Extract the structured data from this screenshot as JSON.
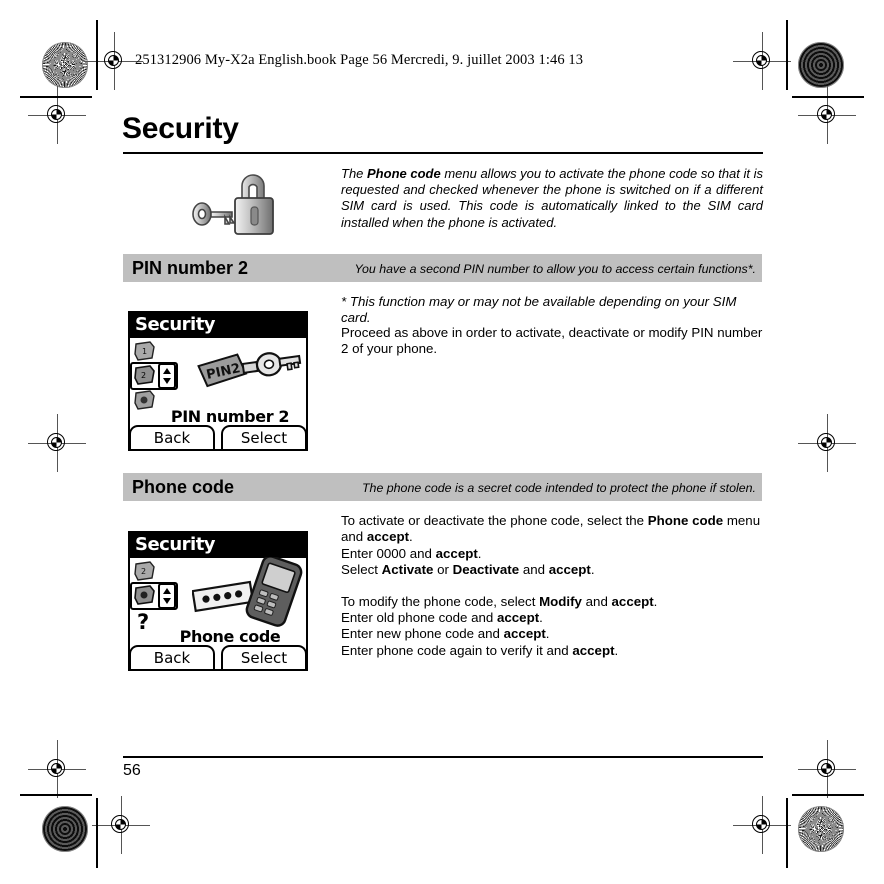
{
  "printer_header": {
    "text": "251312906 My-X2a English.book  Page 56  Mercredi, 9. juillet 2003  1:46 13"
  },
  "page": {
    "title": "Security",
    "number": "56"
  },
  "intro": {
    "text_before": "The ",
    "bold_term": "Phone code",
    "text_after": " menu allows you to activate the phone code so that it is requested and checked whenever the phone is switched on if a different SIM card is used. This code is automatically linked to the SIM card installed when the phone is activated.",
    "icon": "padlock-key-icon"
  },
  "sections": [
    {
      "title": "PIN number 2",
      "description": "You have a second PIN number to allow you to access certain functions*.",
      "footnote": "* This function may or may not be available depending on your SIM card.",
      "body": "Proceed as above in order to activate, deactivate or modify PIN number 2 of your phone.",
      "screenshot": {
        "titlebar": "Security",
        "label": "PIN number 2",
        "graphic_label": "PIN2",
        "softkey_left": "Back",
        "softkey_right": "Select"
      }
    },
    {
      "title": "Phone code",
      "description": "The phone code is a secret code intended to protect the phone if stolen.",
      "screenshot": {
        "titlebar": "Security",
        "label": "Phone code",
        "softkey_left": "Back",
        "softkey_right": "Select"
      },
      "paragraph1": {
        "l1a": "To activate or deactivate the phone code, select the ",
        "l1b": "Phone code",
        "l1c": " menu and ",
        "l1d": "accept",
        "l1e": ".",
        "l2a": "Enter 0000 and ",
        "l2b": "accept",
        "l2c": ".",
        "l3a": "Select ",
        "l3b": "Activate",
        "l3c": " or ",
        "l3d": "Deactivate",
        "l3e": " and ",
        "l3f": "accept",
        "l3g": "."
      },
      "paragraph2": {
        "l1a": "To modify the phone code, select ",
        "l1b": "Modify",
        "l1c": " and ",
        "l1d": "accept",
        "l1e": ".",
        "l2a": "Enter old phone code and ",
        "l2b": "accept",
        "l2c": ".",
        "l3a": "Enter new phone code and ",
        "l3b": "accept",
        "l3c": ".",
        "l4a": "Enter phone code again to verify it and ",
        "l4b": "accept",
        "l4c": "."
      }
    }
  ],
  "colors": {
    "section_bar": "#bfbfbf",
    "text": "#000000",
    "background": "#ffffff"
  }
}
